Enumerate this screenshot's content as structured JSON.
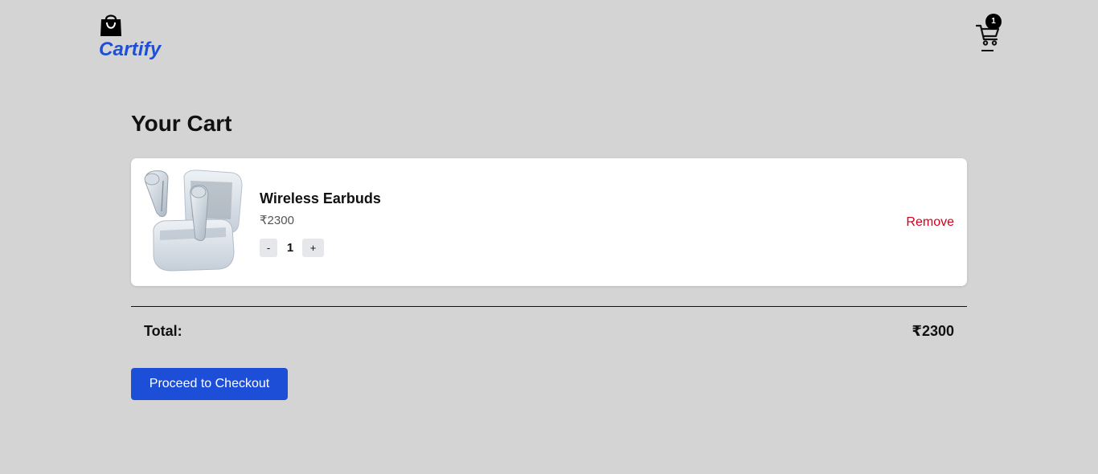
{
  "header": {
    "brand_name": "Cartify",
    "brand_icon": "shopping-bag-icon",
    "cart_icon": "shopping-cart-icon",
    "cart_count": "1"
  },
  "cart": {
    "title": "Your Cart",
    "items": [
      {
        "name": "Wireless Earbuds",
        "price": "₹2300",
        "quantity": "1",
        "decrement_label": "-",
        "increment_label": "+",
        "remove_label": "Remove",
        "image_icon": "wireless-earbuds-image"
      }
    ]
  },
  "summary": {
    "total_label": "Total:",
    "total_value": "₹2300",
    "checkout_label": "Proceed to Checkout"
  },
  "colors": {
    "background": "#d4d4d4",
    "brand": "#1d4ed8",
    "remove": "#d4001a",
    "card": "#ffffff"
  }
}
